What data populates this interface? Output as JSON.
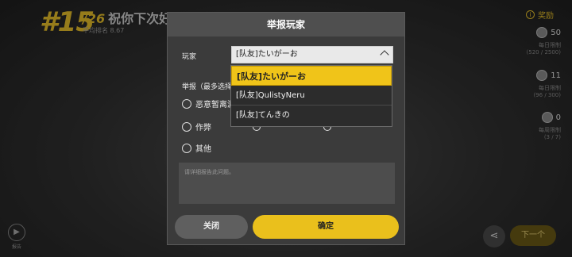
{
  "background": {
    "rank": "#15",
    "total": "/26",
    "cheer": "祝你下次好",
    "subline": "平均排名 8.67",
    "reward_title": "奖励",
    "rewards": [
      {
        "value": "50",
        "label": "每日限制",
        "limit": "(520 / 2500)"
      },
      {
        "value": "11",
        "label": "每日限制",
        "limit": "(96 / 300)"
      },
      {
        "value": "0",
        "label": "每周限制",
        "limit": "(3 / 7)"
      }
    ],
    "report_label": "报告",
    "next_label": "下一个"
  },
  "modal": {
    "title": "举报玩家",
    "player_label": "玩家",
    "selected_player": "[队友]たいがーお",
    "reason_label": "举报（最多选择",
    "reasons": [
      "恶意暂离游",
      "作弊",
      "其他"
    ],
    "detail_placeholder": "请详细报告此问题。",
    "close_label": "关闭",
    "confirm_label": "确定"
  },
  "dropdown": {
    "options": [
      "[队友]たいがーお",
      "[队友]QulistyNeru",
      "[队友]てんきの"
    ]
  },
  "colors": {
    "accent": "#eac01c",
    "modal_bg": "#3b3b3b",
    "header_bg": "#4f4f4f"
  }
}
